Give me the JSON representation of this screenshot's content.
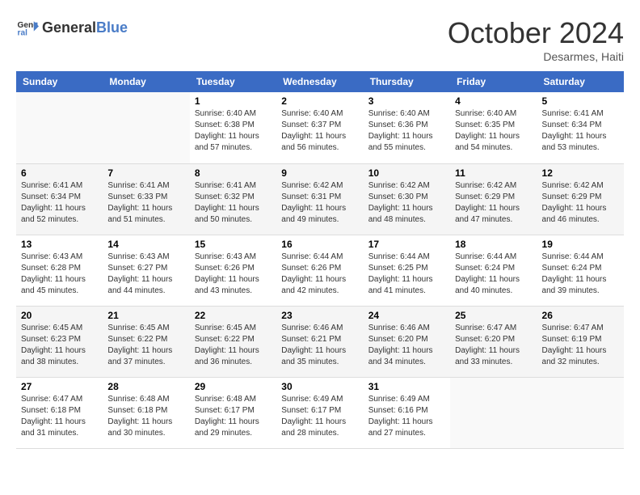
{
  "logo": {
    "text_general": "General",
    "text_blue": "Blue"
  },
  "title": "October 2024",
  "location": "Desarmes, Haiti",
  "days_of_week": [
    "Sunday",
    "Monday",
    "Tuesday",
    "Wednesday",
    "Thursday",
    "Friday",
    "Saturday"
  ],
  "weeks": [
    [
      {
        "day": "",
        "sunrise": "",
        "sunset": "",
        "daylight": ""
      },
      {
        "day": "",
        "sunrise": "",
        "sunset": "",
        "daylight": ""
      },
      {
        "day": "1",
        "sunrise": "Sunrise: 6:40 AM",
        "sunset": "Sunset: 6:38 PM",
        "daylight": "Daylight: 11 hours and 57 minutes."
      },
      {
        "day": "2",
        "sunrise": "Sunrise: 6:40 AM",
        "sunset": "Sunset: 6:37 PM",
        "daylight": "Daylight: 11 hours and 56 minutes."
      },
      {
        "day": "3",
        "sunrise": "Sunrise: 6:40 AM",
        "sunset": "Sunset: 6:36 PM",
        "daylight": "Daylight: 11 hours and 55 minutes."
      },
      {
        "day": "4",
        "sunrise": "Sunrise: 6:40 AM",
        "sunset": "Sunset: 6:35 PM",
        "daylight": "Daylight: 11 hours and 54 minutes."
      },
      {
        "day": "5",
        "sunrise": "Sunrise: 6:41 AM",
        "sunset": "Sunset: 6:34 PM",
        "daylight": "Daylight: 11 hours and 53 minutes."
      }
    ],
    [
      {
        "day": "6",
        "sunrise": "Sunrise: 6:41 AM",
        "sunset": "Sunset: 6:34 PM",
        "daylight": "Daylight: 11 hours and 52 minutes."
      },
      {
        "day": "7",
        "sunrise": "Sunrise: 6:41 AM",
        "sunset": "Sunset: 6:33 PM",
        "daylight": "Daylight: 11 hours and 51 minutes."
      },
      {
        "day": "8",
        "sunrise": "Sunrise: 6:41 AM",
        "sunset": "Sunset: 6:32 PM",
        "daylight": "Daylight: 11 hours and 50 minutes."
      },
      {
        "day": "9",
        "sunrise": "Sunrise: 6:42 AM",
        "sunset": "Sunset: 6:31 PM",
        "daylight": "Daylight: 11 hours and 49 minutes."
      },
      {
        "day": "10",
        "sunrise": "Sunrise: 6:42 AM",
        "sunset": "Sunset: 6:30 PM",
        "daylight": "Daylight: 11 hours and 48 minutes."
      },
      {
        "day": "11",
        "sunrise": "Sunrise: 6:42 AM",
        "sunset": "Sunset: 6:29 PM",
        "daylight": "Daylight: 11 hours and 47 minutes."
      },
      {
        "day": "12",
        "sunrise": "Sunrise: 6:42 AM",
        "sunset": "Sunset: 6:29 PM",
        "daylight": "Daylight: 11 hours and 46 minutes."
      }
    ],
    [
      {
        "day": "13",
        "sunrise": "Sunrise: 6:43 AM",
        "sunset": "Sunset: 6:28 PM",
        "daylight": "Daylight: 11 hours and 45 minutes."
      },
      {
        "day": "14",
        "sunrise": "Sunrise: 6:43 AM",
        "sunset": "Sunset: 6:27 PM",
        "daylight": "Daylight: 11 hours and 44 minutes."
      },
      {
        "day": "15",
        "sunrise": "Sunrise: 6:43 AM",
        "sunset": "Sunset: 6:26 PM",
        "daylight": "Daylight: 11 hours and 43 minutes."
      },
      {
        "day": "16",
        "sunrise": "Sunrise: 6:44 AM",
        "sunset": "Sunset: 6:26 PM",
        "daylight": "Daylight: 11 hours and 42 minutes."
      },
      {
        "day": "17",
        "sunrise": "Sunrise: 6:44 AM",
        "sunset": "Sunset: 6:25 PM",
        "daylight": "Daylight: 11 hours and 41 minutes."
      },
      {
        "day": "18",
        "sunrise": "Sunrise: 6:44 AM",
        "sunset": "Sunset: 6:24 PM",
        "daylight": "Daylight: 11 hours and 40 minutes."
      },
      {
        "day": "19",
        "sunrise": "Sunrise: 6:44 AM",
        "sunset": "Sunset: 6:24 PM",
        "daylight": "Daylight: 11 hours and 39 minutes."
      }
    ],
    [
      {
        "day": "20",
        "sunrise": "Sunrise: 6:45 AM",
        "sunset": "Sunset: 6:23 PM",
        "daylight": "Daylight: 11 hours and 38 minutes."
      },
      {
        "day": "21",
        "sunrise": "Sunrise: 6:45 AM",
        "sunset": "Sunset: 6:22 PM",
        "daylight": "Daylight: 11 hours and 37 minutes."
      },
      {
        "day": "22",
        "sunrise": "Sunrise: 6:45 AM",
        "sunset": "Sunset: 6:22 PM",
        "daylight": "Daylight: 11 hours and 36 minutes."
      },
      {
        "day": "23",
        "sunrise": "Sunrise: 6:46 AM",
        "sunset": "Sunset: 6:21 PM",
        "daylight": "Daylight: 11 hours and 35 minutes."
      },
      {
        "day": "24",
        "sunrise": "Sunrise: 6:46 AM",
        "sunset": "Sunset: 6:20 PM",
        "daylight": "Daylight: 11 hours and 34 minutes."
      },
      {
        "day": "25",
        "sunrise": "Sunrise: 6:47 AM",
        "sunset": "Sunset: 6:20 PM",
        "daylight": "Daylight: 11 hours and 33 minutes."
      },
      {
        "day": "26",
        "sunrise": "Sunrise: 6:47 AM",
        "sunset": "Sunset: 6:19 PM",
        "daylight": "Daylight: 11 hours and 32 minutes."
      }
    ],
    [
      {
        "day": "27",
        "sunrise": "Sunrise: 6:47 AM",
        "sunset": "Sunset: 6:18 PM",
        "daylight": "Daylight: 11 hours and 31 minutes."
      },
      {
        "day": "28",
        "sunrise": "Sunrise: 6:48 AM",
        "sunset": "Sunset: 6:18 PM",
        "daylight": "Daylight: 11 hours and 30 minutes."
      },
      {
        "day": "29",
        "sunrise": "Sunrise: 6:48 AM",
        "sunset": "Sunset: 6:17 PM",
        "daylight": "Daylight: 11 hours and 29 minutes."
      },
      {
        "day": "30",
        "sunrise": "Sunrise: 6:49 AM",
        "sunset": "Sunset: 6:17 PM",
        "daylight": "Daylight: 11 hours and 28 minutes."
      },
      {
        "day": "31",
        "sunrise": "Sunrise: 6:49 AM",
        "sunset": "Sunset: 6:16 PM",
        "daylight": "Daylight: 11 hours and 27 minutes."
      },
      {
        "day": "",
        "sunrise": "",
        "sunset": "",
        "daylight": ""
      },
      {
        "day": "",
        "sunrise": "",
        "sunset": "",
        "daylight": ""
      }
    ]
  ]
}
